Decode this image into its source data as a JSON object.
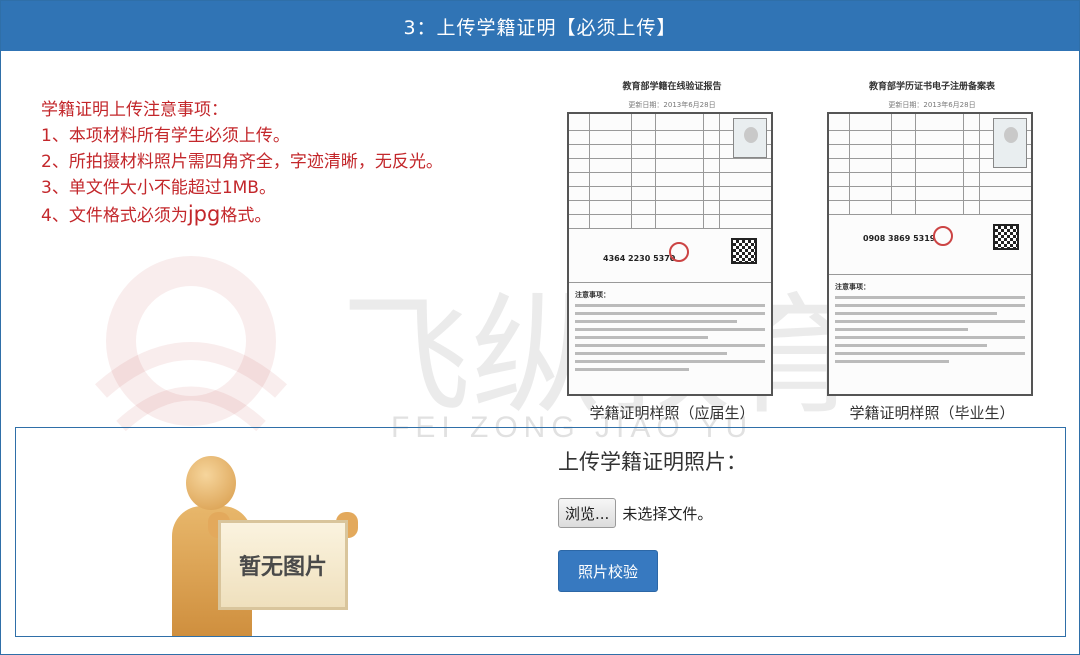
{
  "header": {
    "title": "3：上传学籍证明【必须上传】"
  },
  "notice": {
    "heading": "学籍证明上传注意事项：",
    "items": [
      "1、本项材料所有学生必须上传。",
      "2、所拍摄材料照片需四角齐全，字迹清晰，无反光。",
      "3、单文件大小不能超过1MB。",
      "4、文件格式必须为"
    ],
    "item4_ext": "jpg",
    "item4_tail": "格式。"
  },
  "samples": [
    {
      "doc_title": "教育部学籍在线验证报告",
      "doc_date": "更新日期：2013年6月28日",
      "code": "4364 2230 5370",
      "caption": "学籍证明样照（应届生）"
    },
    {
      "doc_title": "教育部学历证书电子注册备案表",
      "doc_date": "更新日期：2013年6月28日",
      "code": "0908 3869 5319",
      "caption": "学籍证明样照（毕业生）"
    }
  ],
  "notes_heading": "注意事项：",
  "watermark": {
    "text": "飞纵教育",
    "pinyin": "FEI ZONG JIAO YU"
  },
  "upload": {
    "title": "上传学籍证明照片：",
    "browse_label": "浏览...",
    "file_status": "未选择文件。",
    "verify_label": "照片校验",
    "placeholder_text": "暂无图片"
  },
  "colors": {
    "header_bg": "#3074b5",
    "notice_red": "#c3272b",
    "button_blue": "#3779c0"
  }
}
